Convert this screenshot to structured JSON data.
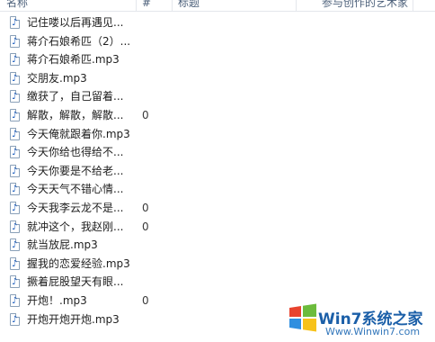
{
  "columns": {
    "name": "名称",
    "number": "#",
    "title": "标题",
    "artist": "参与创作的艺术家"
  },
  "files": [
    {
      "name": "记住喽以后再遇见...",
      "number": "",
      "icon": "audio-file-icon"
    },
    {
      "name": "蒋介石娘希匹（2）...",
      "number": "",
      "icon": "audio-file-icon"
    },
    {
      "name": "蒋介石娘希匹.mp3",
      "number": "",
      "icon": "audio-file-icon"
    },
    {
      "name": "交朋友.mp3",
      "number": "",
      "icon": "audio-file-icon"
    },
    {
      "name": "缴获了，自己留着...",
      "number": "",
      "icon": "audio-file-icon"
    },
    {
      "name": "解散，解散，解散...",
      "number": "0",
      "icon": "audio-file-icon"
    },
    {
      "name": "今天俺就跟着你.mp3",
      "number": "",
      "icon": "audio-file-icon"
    },
    {
      "name": "今天你给也得给不...",
      "number": "",
      "icon": "audio-file-icon"
    },
    {
      "name": "今天你要是不给老...",
      "number": "",
      "icon": "audio-file-icon"
    },
    {
      "name": "今天天气不错心情...",
      "number": "",
      "icon": "audio-file-icon"
    },
    {
      "name": "今天我李云龙不是...",
      "number": "0",
      "icon": "audio-file-icon"
    },
    {
      "name": "就冲这个，我赵刚...",
      "number": "0",
      "icon": "audio-file-icon"
    },
    {
      "name": "就当放屁.mp3",
      "number": "",
      "icon": "audio-file-icon"
    },
    {
      "name": "握我的恋爱经验.mp3",
      "number": "",
      "icon": "audio-file-icon"
    },
    {
      "name": "撅着屁股望天有眼...",
      "number": "",
      "icon": "audio-file-icon"
    },
    {
      "name": "开炮！.mp3",
      "number": "0",
      "icon": "audio-file-icon"
    },
    {
      "name": "开炮开炮开炮.mp3",
      "number": "",
      "icon": "audio-file-icon"
    }
  ],
  "watermark": {
    "text": "Win7系统之家",
    "url": "Www.Winwin7.com"
  }
}
